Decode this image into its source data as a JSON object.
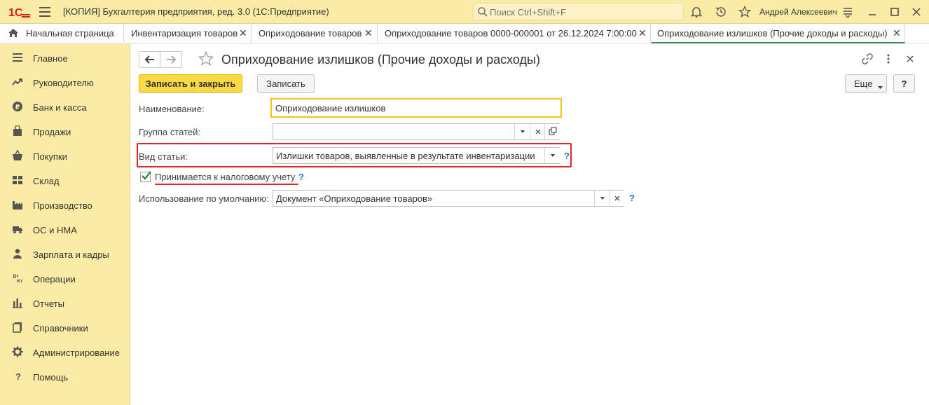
{
  "app": {
    "title": "[КОПИЯ] Бухгалтерия предприятия, ред. 3.0  (1С:Предприятие)",
    "logo_text": "1С",
    "search_placeholder": "Поиск Ctrl+Shift+F",
    "user": "Андрей Алексеевич"
  },
  "tabs": [
    {
      "label": "Начальная страница",
      "closable": false
    },
    {
      "label": "Инвентаризация товаров",
      "closable": true
    },
    {
      "label": "Оприходование товаров",
      "closable": true
    },
    {
      "label": "Оприходование товаров 0000-000001 от 26.12.2024 7:00:00",
      "closable": true
    },
    {
      "label": "Оприходование излишков (Прочие доходы и расходы)",
      "closable": true,
      "active": true
    }
  ],
  "sidebar": {
    "items": [
      {
        "label": "Главное",
        "icon": "menu-lines-icon"
      },
      {
        "label": "Руководителю",
        "icon": "trend-icon"
      },
      {
        "label": "Банк и касса",
        "icon": "ruble-coin-icon"
      },
      {
        "label": "Продажи",
        "icon": "shopping-bag-icon"
      },
      {
        "label": "Покупки",
        "icon": "shopping-basket-icon"
      },
      {
        "label": "Склад",
        "icon": "warehouse-icon"
      },
      {
        "label": "Производство",
        "icon": "factory-icon"
      },
      {
        "label": "ОС и НМА",
        "icon": "truck-icon"
      },
      {
        "label": "Зарплата и кадры",
        "icon": "people-icon"
      },
      {
        "label": "Операции",
        "icon": "dt-kt-icon"
      },
      {
        "label": "Отчеты",
        "icon": "bar-chart-icon"
      },
      {
        "label": "Справочники",
        "icon": "books-icon"
      },
      {
        "label": "Администрирование",
        "icon": "gear-icon"
      },
      {
        "label": "Помощь",
        "icon": "question-icon"
      }
    ]
  },
  "form": {
    "title": "Оприходование излишков (Прочие доходы и расходы)",
    "save_close_label": "Записать и закрыть",
    "save_label": "Записать",
    "more_label": "Еще",
    "help_label": "?",
    "name_label": "Наименование:",
    "name_value": "Оприходование излишков",
    "group_label": "Группа статей:",
    "group_value": "",
    "kind_label": "Вид статьи:",
    "kind_value": "Излишки товаров, выявленные в результате инвентаризации",
    "tax_label": "Принимается к налоговому учету",
    "tax_checked": true,
    "usage_label": "Использование по умолчанию:",
    "usage_value": "Документ «Оприходование товаров»",
    "hint_mark": "?"
  },
  "colors": {
    "panel_yellow": "#fbeca5",
    "primary_button": "#fbd942",
    "highlight_red": "#e32626",
    "active_tab_green": "#3a8a52",
    "hint_blue": "#1a7ac4",
    "focus_border": "#f0c419"
  }
}
